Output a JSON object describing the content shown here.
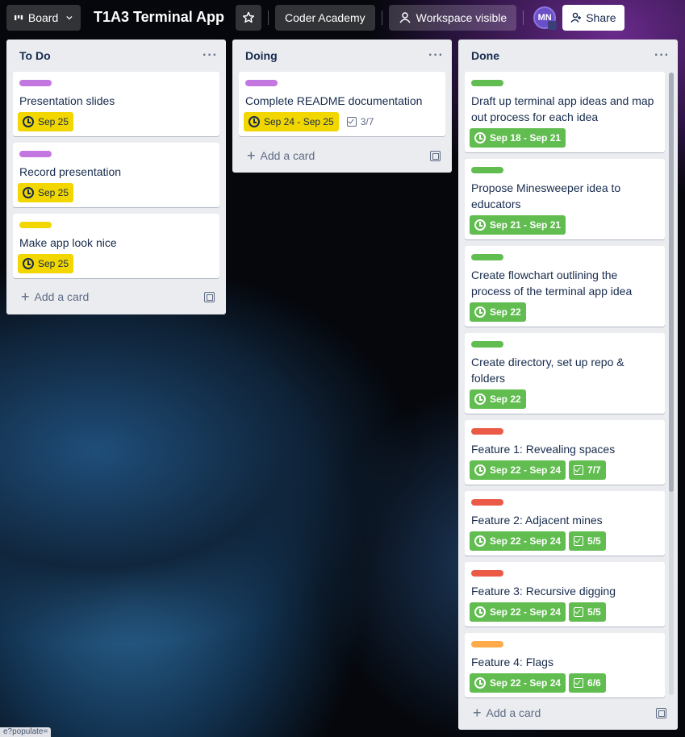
{
  "header": {
    "board_label": "Board",
    "board_title": "T1A3 Terminal App",
    "workspace": "Coder Academy",
    "visibility": "Workspace visible",
    "avatar_initials": "MN",
    "share_label": "Share"
  },
  "lists": [
    {
      "title": "To Do",
      "add_card_label": "Add a card",
      "cards": [
        {
          "label_color": "#c377e0",
          "title": "Presentation slides",
          "due": "Sep 25",
          "due_color": "yellow"
        },
        {
          "label_color": "#c377e0",
          "title": "Record presentation",
          "due": "Sep 25",
          "due_color": "yellow"
        },
        {
          "label_color": "#f2d600",
          "title": "Make app look nice",
          "due": "Sep 25",
          "due_color": "yellow"
        }
      ]
    },
    {
      "title": "Doing",
      "add_card_label": "Add a card",
      "cards": [
        {
          "label_color": "#c377e0",
          "title": "Complete README documentation",
          "due": "Sep 24 - Sep 25",
          "due_color": "yellow",
          "checklist": "3/7"
        }
      ]
    },
    {
      "title": "Done",
      "add_card_label": "Add a card",
      "cards": [
        {
          "label_color": "#61bd4f",
          "title": "Draft up terminal app ideas and map out process for each idea",
          "due": "Sep 18 - Sep 21",
          "due_color": "green"
        },
        {
          "label_color": "#61bd4f",
          "title": "Propose Minesweeper idea to educators",
          "due": "Sep 21 - Sep 21",
          "due_color": "green"
        },
        {
          "label_color": "#61bd4f",
          "title": "Create flowchart outlining the process of the terminal app idea",
          "due": "Sep 22",
          "due_color": "green"
        },
        {
          "label_color": "#61bd4f",
          "title": "Create directory, set up repo & folders",
          "due": "Sep 22",
          "due_color": "green"
        },
        {
          "label_color": "#eb5a46",
          "title": "Feature 1: Revealing spaces",
          "due": "Sep 22 - Sep 24",
          "due_color": "green",
          "checklist": "7/7"
        },
        {
          "label_color": "#eb5a46",
          "title": "Feature 2: Adjacent mines",
          "due": "Sep 22 - Sep 24",
          "due_color": "green",
          "checklist": "5/5"
        },
        {
          "label_color": "#eb5a46",
          "title": "Feature 3: Recursive digging",
          "due": "Sep 22 - Sep 24",
          "due_color": "green",
          "checklist": "5/5"
        },
        {
          "label_color": "#ffab4a",
          "title": "Feature 4: Flags",
          "due": "Sep 22 - Sep 24",
          "due_color": "green",
          "checklist": "6/6"
        }
      ]
    }
  ],
  "status_bar_text": "e?populate="
}
